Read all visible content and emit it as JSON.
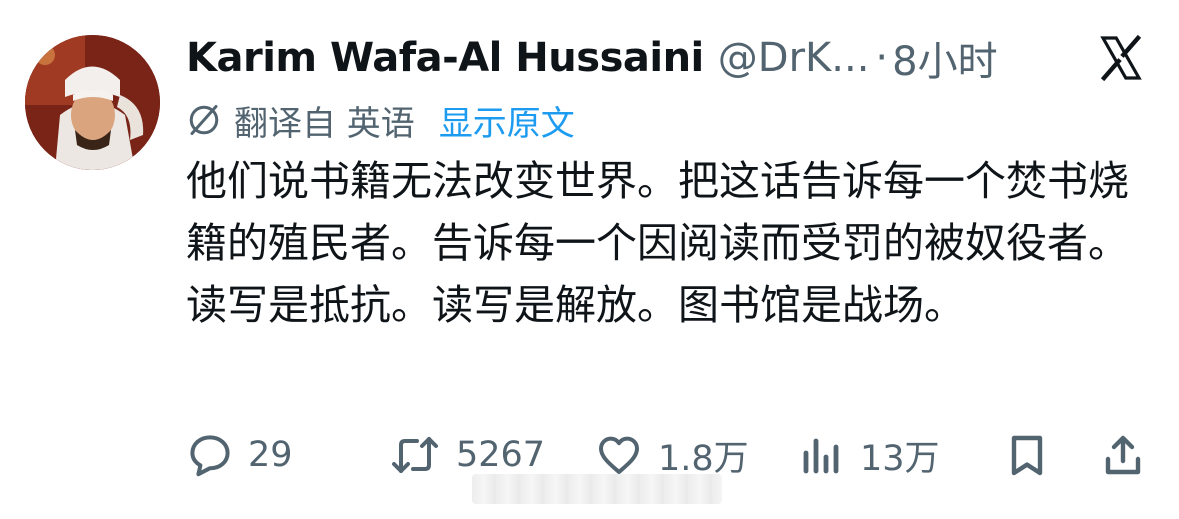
{
  "author": {
    "display_name": "Karim Wafa-Al Hussaini",
    "handle": "@DrK...",
    "separator": "·",
    "time": "8小时"
  },
  "translation": {
    "label": "翻译自 英语",
    "show_original": "显示原文"
  },
  "tweet_text": "他们说书籍无法改变世界。把这话告诉每一个焚书烧籍的殖民者。告诉每一个因阅读而受罚的被奴役者。读写是抵抗。读写是解放。图书馆是战场。",
  "actions": {
    "replies": "29",
    "retweets": "5267",
    "likes": "1.8万",
    "views": "13万"
  },
  "icons": {
    "brand": "x-logo-icon",
    "translate": "translate-icon",
    "reply": "reply-icon",
    "retweet": "retweet-icon",
    "like": "heart-icon",
    "views": "views-icon",
    "bookmark": "bookmark-icon",
    "share": "share-icon"
  },
  "colors": {
    "text": "#0f1419",
    "secondary": "#536471",
    "link": "#1d9bf0"
  }
}
